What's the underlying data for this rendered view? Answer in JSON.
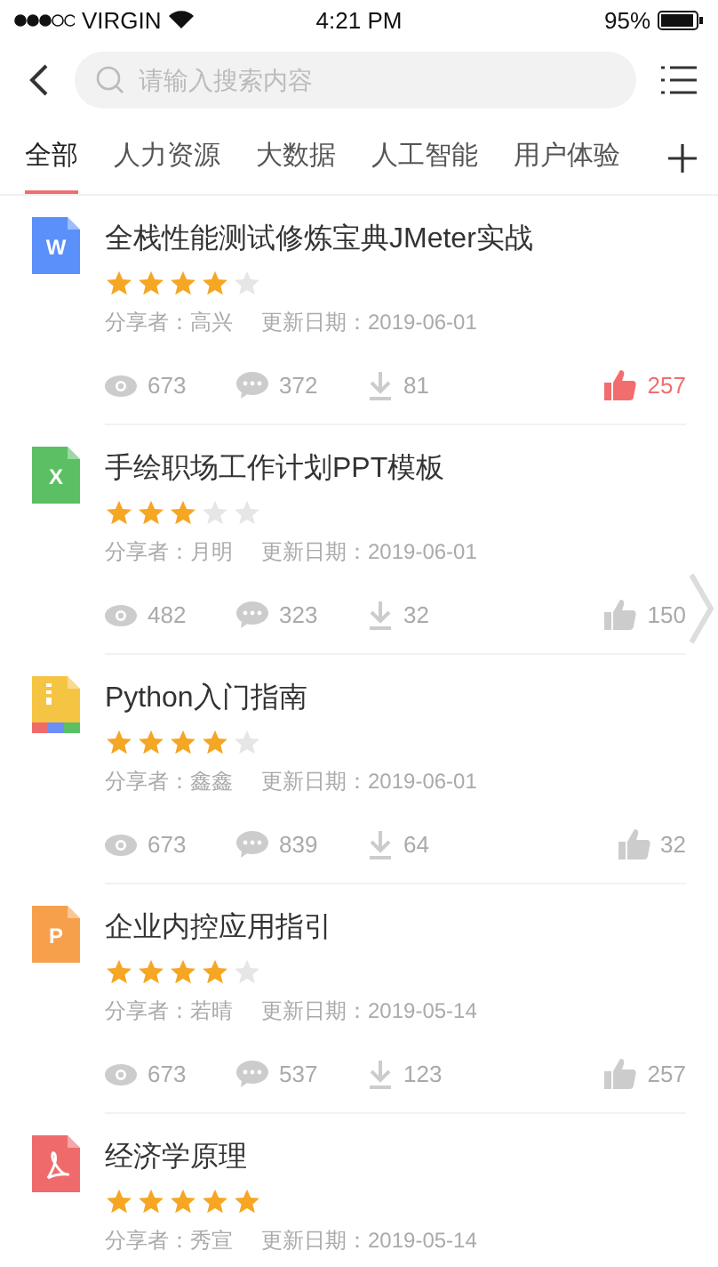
{
  "status_bar": {
    "carrier": "VIRGIN",
    "time": "4:21 PM",
    "battery": "95%"
  },
  "search": {
    "placeholder": "请输入搜索内容"
  },
  "tabs": [
    {
      "label": "全部",
      "selected": true
    },
    {
      "label": "人力资源",
      "selected": false
    },
    {
      "label": "大数据",
      "selected": false
    },
    {
      "label": "人工智能",
      "selected": false
    },
    {
      "label": "用户体验",
      "selected": false
    }
  ],
  "items": [
    {
      "kind": "word",
      "badge": "W",
      "title": "全栈性能测试修炼宝典JMeter实战",
      "stars": 4,
      "sharer_label": "分享者：",
      "sharer": "高兴",
      "date_label": "更新日期：",
      "date": "2019-06-01",
      "views": "673",
      "comments": "372",
      "downloads": "81",
      "likes": "257",
      "liked": true
    },
    {
      "kind": "excel",
      "badge": "X",
      "title": "手绘职场工作计划PPT模板",
      "stars": 3,
      "sharer_label": "分享者：",
      "sharer": "月明",
      "date_label": "更新日期：",
      "date": "2019-06-01",
      "views": "482",
      "comments": "323",
      "downloads": "32",
      "likes": "150",
      "liked": false
    },
    {
      "kind": "zip",
      "title": "Python入门指南",
      "stars": 4,
      "sharer_label": "分享者：",
      "sharer": "鑫鑫",
      "date_label": "更新日期：",
      "date": "2019-06-01",
      "views": "673",
      "comments": "839",
      "downloads": "64",
      "likes": "32",
      "liked": false
    },
    {
      "kind": "ppt",
      "badge": "P",
      "title": "企业内控应用指引",
      "stars": 4,
      "sharer_label": "分享者：",
      "sharer": "若晴",
      "date_label": "更新日期：",
      "date": "2019-05-14",
      "views": "673",
      "comments": "537",
      "downloads": "123",
      "likes": "257",
      "liked": false
    },
    {
      "kind": "pdf",
      "title": "经济学原理",
      "stars": 5,
      "sharer_label": "分享者：",
      "sharer": "秀宣",
      "date_label": "更新日期：",
      "date": "2019-05-14"
    }
  ]
}
